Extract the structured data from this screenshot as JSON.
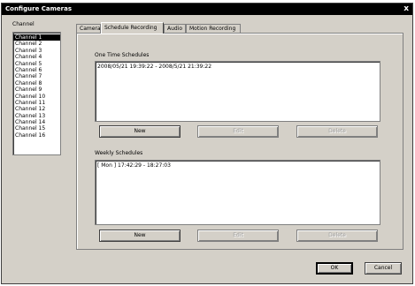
{
  "window": {
    "title": "Configure Cameras",
    "close_glyph": "x"
  },
  "channels": {
    "label": "Channel",
    "items": [
      "Channel 1",
      "Channel 2",
      "Channel 3",
      "Channel 4",
      "Channel 5",
      "Channel 6",
      "Channel 7",
      "Channel 8",
      "Channel 9",
      "Channel 10",
      "Channel 11",
      "Channel 12",
      "Channel 13",
      "Channel 14",
      "Channel 15",
      "Channel 16"
    ],
    "selected": "Channel 1"
  },
  "tabs": [
    {
      "label": "Camera",
      "active": false
    },
    {
      "label": "Schedule Recording",
      "active": true
    },
    {
      "label": "Audio",
      "active": false
    },
    {
      "label": "Motion Recording",
      "active": false
    }
  ],
  "one_time": {
    "label": "One Time Schedules",
    "entries": [
      "2008/05/21 19:39:22 - 2008/5/21 21:39:22"
    ],
    "new_label": "New",
    "edit_label": "Edit",
    "delete_label": "Delete"
  },
  "weekly": {
    "label": "Weekly Schedules",
    "entries": [
      "[ Mon ] 17:42:29 - 18:27:03"
    ],
    "new_label": "New",
    "edit_label": "Edit",
    "delete_label": "Delete"
  },
  "footer": {
    "ok_label": "OK",
    "cancel_label": "Cancel"
  },
  "colors": {
    "dialog_bg": "#d4d0c8",
    "titlebar_bg": "#000000",
    "selection_bg": "#000000"
  }
}
